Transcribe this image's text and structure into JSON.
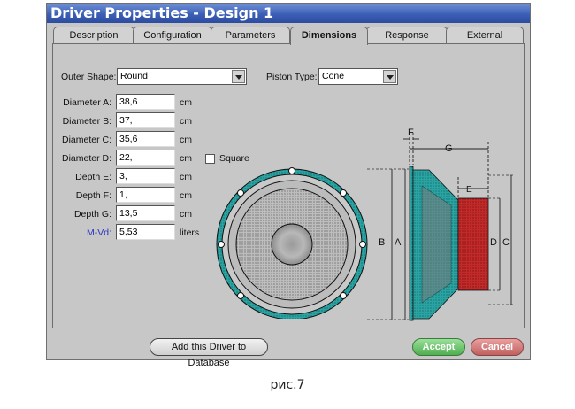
{
  "window": {
    "title": "Driver Properties - Design 1"
  },
  "tabs": [
    {
      "label": "Description"
    },
    {
      "label": "Configuration"
    },
    {
      "label": "Parameters"
    },
    {
      "label": "Dimensions"
    },
    {
      "label": "Response"
    },
    {
      "label": "External"
    }
  ],
  "active_tab": "Dimensions",
  "outer_shape": {
    "label": "Outer Shape:",
    "value": "Round"
  },
  "piston_type": {
    "label": "Piston Type:",
    "value": "Cone"
  },
  "fields": [
    {
      "label": "Diameter A:",
      "value": "38,6",
      "unit": "cm"
    },
    {
      "label": "Diameter B:",
      "value": "37,",
      "unit": "cm"
    },
    {
      "label": "Diameter C:",
      "value": "35,6",
      "unit": "cm"
    },
    {
      "label": "Diameter D:",
      "value": "22,",
      "unit": "cm"
    },
    {
      "label": "Depth E:",
      "value": "3,",
      "unit": "cm"
    },
    {
      "label": "Depth F:",
      "value": "1,",
      "unit": "cm"
    },
    {
      "label": "Depth G:",
      "value": "13,5",
      "unit": "cm"
    },
    {
      "label": "M-Vd:",
      "value": "5,53",
      "unit": "liters"
    }
  ],
  "square": {
    "label": "Square",
    "checked": false
  },
  "diagram_labels": {
    "a": "A",
    "b": "B",
    "c": "C",
    "d": "D",
    "e": "E",
    "f": "F",
    "g": "G"
  },
  "buttons": {
    "add_driver": "Add this Driver to Database",
    "accept": "Accept",
    "cancel": "Cancel"
  },
  "caption": "рис.7",
  "colors": {
    "title_bar": "#3c5fb5",
    "basket": "#2a9a9a",
    "magnet": "#b22222",
    "accept": "#4fae4f",
    "cancel": "#c05f5f"
  }
}
